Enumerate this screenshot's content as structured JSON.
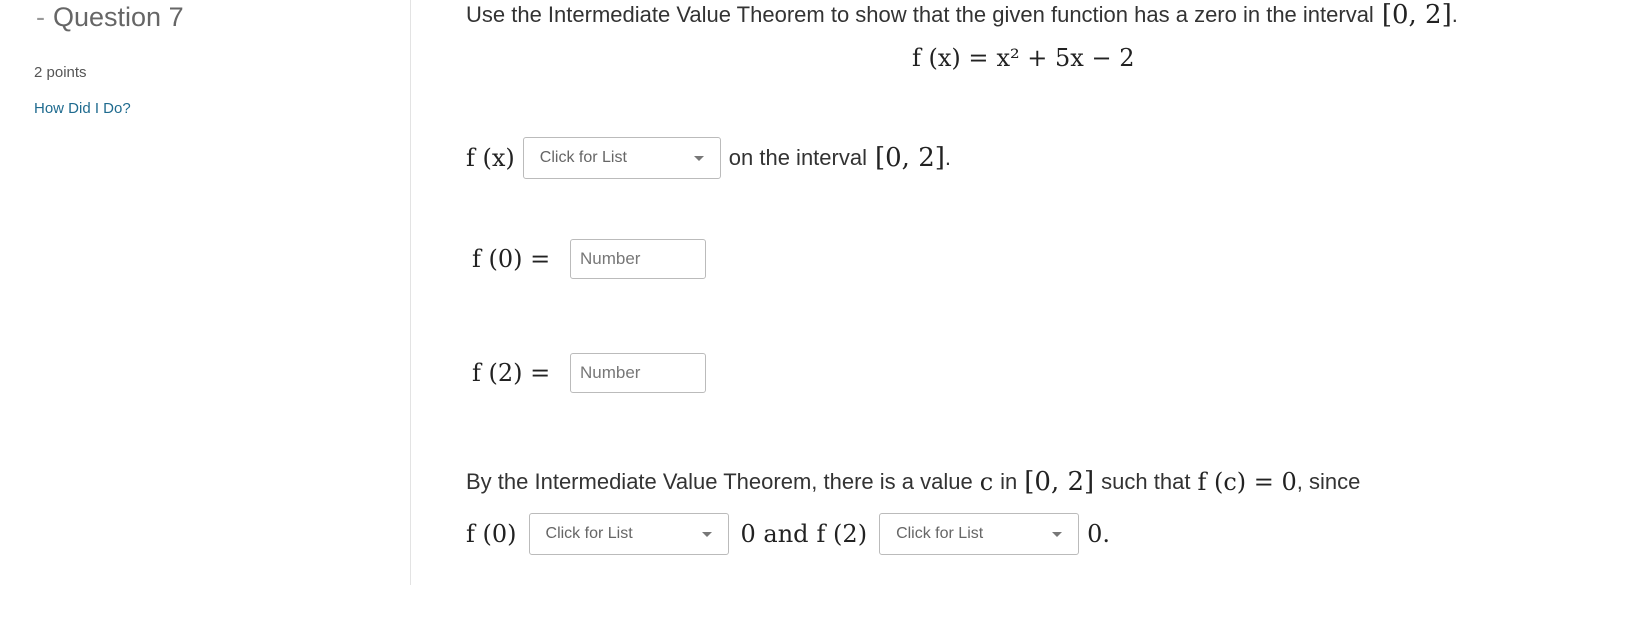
{
  "sidebar": {
    "dash": "-",
    "question_title": "Question 7",
    "points": "2 points",
    "how_did_i_do": "How Did I Do?"
  },
  "prompt": {
    "text": "Use the Intermediate Value Theorem to show that the given function has a zero in the interval",
    "interval": "[0, 2]",
    "period": ".",
    "function_lhs": "f (x) =",
    "function_rhs": "x² + 5x − 2"
  },
  "row1": {
    "label": "f (x)",
    "select_label": "Click for List",
    "text": "on the interval",
    "interval": "[0, 2]",
    "period": "."
  },
  "row2": {
    "label": "f (0) =",
    "placeholder": "Number"
  },
  "row3": {
    "label": "f (2) =",
    "placeholder": "Number"
  },
  "conclusion": {
    "text_a": "By the Intermediate Value Theorem, there is a value",
    "c": "c",
    "text_b": "in",
    "interval": "[0, 2]",
    "text_c": "such that",
    "fc": "f (c) = 0",
    "text_d": ", since",
    "f0": "f (0)",
    "select1_label": "Click for List",
    "zero_and": "0 and",
    "f2": "f (2)",
    "select2_label": "Click for List",
    "zero_end": "0."
  }
}
